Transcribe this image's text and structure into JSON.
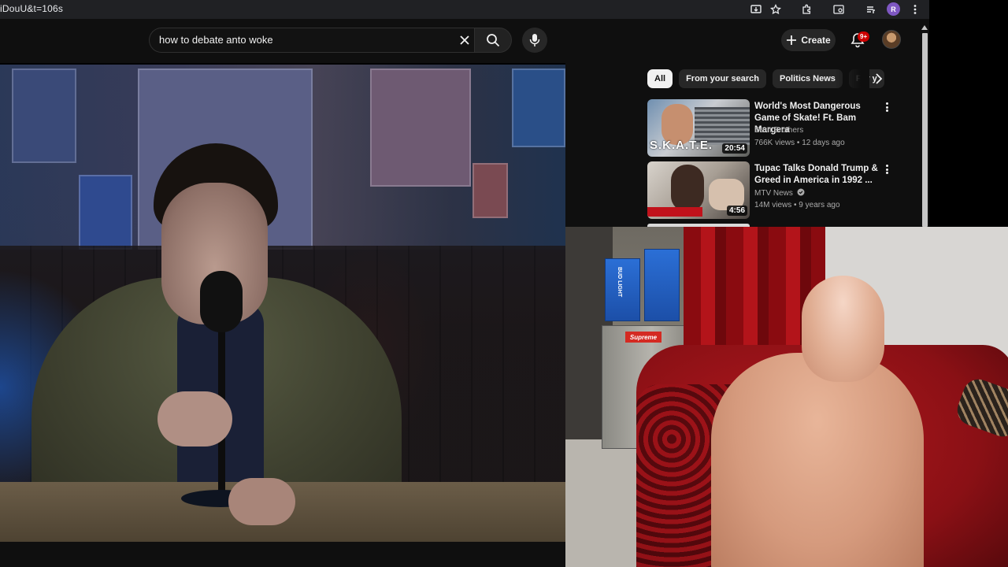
{
  "browser": {
    "url_fragment": "iDouU&t=106s",
    "profile_initial": "R"
  },
  "header": {
    "search_query": "how to debate anto woke",
    "create_label": "Create",
    "notification_badge": "9+"
  },
  "sidebar": {
    "chips": [
      {
        "label": "All",
        "active": true
      },
      {
        "label": "From your search",
        "active": false
      },
      {
        "label": "Politics News",
        "active": false
      },
      {
        "label": "For y",
        "active": false
      }
    ],
    "recommendations": [
      {
        "title": "World's Most Dangerous Game of Skate! Ft. Bam Margera",
        "channel": "Dern Brothers",
        "meta": "766K views • 12 days ago",
        "duration": "20:54",
        "thumb_overlay_text": "S.K.A.T.E.",
        "verified": false
      },
      {
        "title": "Tupac Talks Donald Trump & Greed in America in 1992 ...",
        "channel": "MTV News",
        "meta": "14M views • 9 years ago",
        "duration": "4:56",
        "verified": true
      }
    ]
  },
  "webcam": {
    "fridge_label": "Supreme",
    "box_label": "BUD LIGHT"
  },
  "colors": {
    "yt_background": "#0f0f0f",
    "chip_bg": "#272727",
    "badge_red": "#cc0000"
  }
}
